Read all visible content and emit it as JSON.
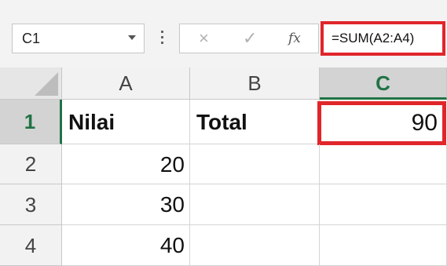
{
  "formula_bar": {
    "name_box": "C1",
    "cancel_symbol": "×",
    "enter_symbol": "✓",
    "fx_symbol": "fx",
    "formula": "=SUM(A2:A4)"
  },
  "columns": [
    "A",
    "B",
    "C"
  ],
  "active_column": "C",
  "rows": [
    {
      "header": "1",
      "cells": [
        "Nilai",
        "Total",
        "90"
      ]
    },
    {
      "header": "2",
      "cells": [
        "20",
        "",
        ""
      ]
    },
    {
      "header": "3",
      "cells": [
        "30",
        "",
        ""
      ]
    },
    {
      "header": "4",
      "cells": [
        "40",
        "",
        ""
      ]
    }
  ],
  "active_row": "1",
  "colors": {
    "selection_highlight": "#e0262b",
    "active_header_accent": "#217346"
  }
}
